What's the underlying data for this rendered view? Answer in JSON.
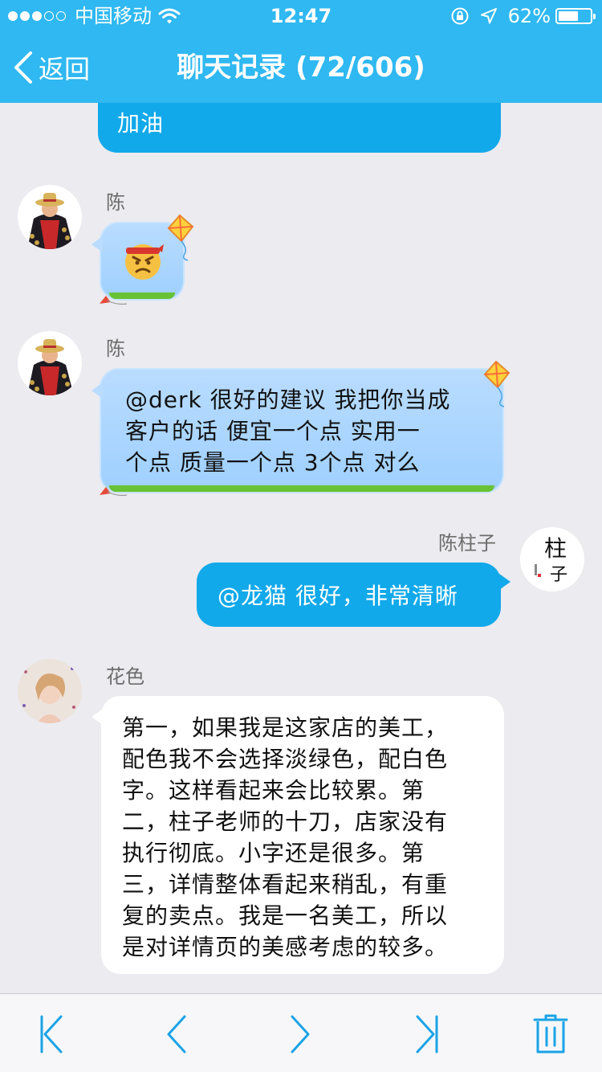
{
  "status_bar": {
    "carrier": "中国移动",
    "time": "12:47",
    "battery_percent": "62%",
    "battery_level": 0.62
  },
  "nav": {
    "back_label": "返回",
    "title": "聊天记录 (72/606)"
  },
  "messages": [
    {
      "side": "right",
      "style": "blue",
      "text": "加油"
    },
    {
      "side": "left",
      "sender": "陈",
      "style": "kite",
      "emoji": "angry-headband-emoji"
    },
    {
      "side": "left",
      "sender": "陈",
      "style": "kite",
      "lines": [
        "@derk 很好的建议  我把你当成",
        "客户的话  便宜一个点   实用一",
        "个点  质量一个点  3个点  对么"
      ]
    },
    {
      "side": "right",
      "sender": "陈柱子",
      "style": "blue",
      "text": "@龙猫 很好，非常清晰"
    },
    {
      "side": "left",
      "sender": "花色",
      "style": "white",
      "lines": [
        "第一，如果我是这家店的美工，",
        "配色我不会选择淡绿色，配白色",
        "字。这样看起来会比较累。第",
        "二，柱子老师的十刀，店家没有",
        "执行彻底。小字还是很多。第",
        "三，详情整体看起来稍乱，有重",
        "复的卖点。我是一名美工，所以",
        "是对详情页的美感考虑的较多。"
      ]
    }
  ],
  "avatars": {
    "zhuzi_text_top": "柱",
    "zhuzi_text_bottom": "子"
  },
  "toolbar": {
    "icons": [
      "first-page-icon",
      "previous-page-icon",
      "next-page-icon",
      "last-page-icon",
      "trash-icon"
    ],
    "accent": "#1aa3e6"
  },
  "colors": {
    "header": "#2fb8f1",
    "bubble_blue": "#12a9ea",
    "background": "#ebebf0"
  }
}
